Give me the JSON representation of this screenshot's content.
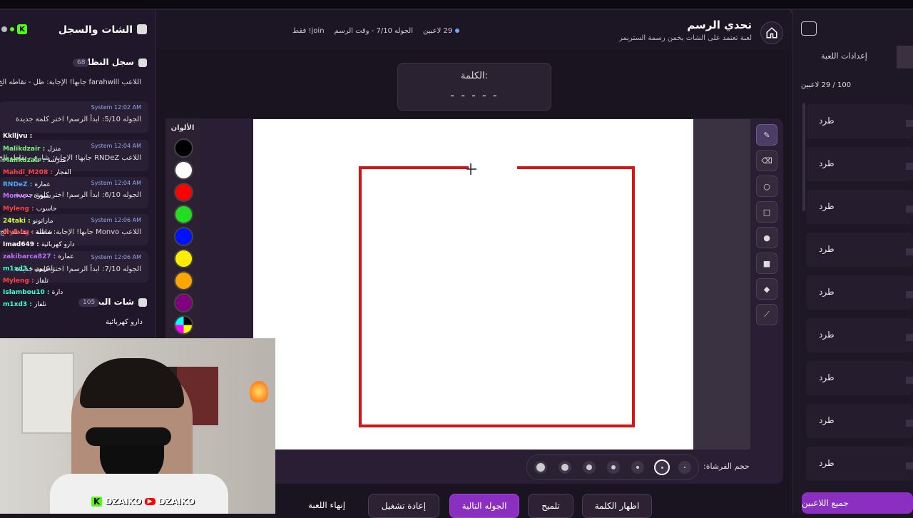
{
  "header": {
    "title": "تحدي الرسم",
    "subtitle": "لعبة تعتمد على الشات يخمن رسمة الستريمر",
    "players_count": "29 لاعبين",
    "round_info": "الجوله 7/10 - وقت الرسم",
    "join_info": "join! فقط"
  },
  "word_card": {
    "label": "الكلمة:",
    "blanks": "- - - - -"
  },
  "palette": {
    "title": "الألوان",
    "colors": [
      "#000000",
      "#ffffff",
      "#ff0000",
      "#22dd22",
      "#0011ff",
      "#ffee00",
      "#ffa500",
      "#800080"
    ]
  },
  "brush": {
    "label": "حجم الفرشاة:"
  },
  "tools": [
    "brush-icon",
    "eraser-icon",
    "circle-icon",
    "square-icon",
    "filled-circle-icon",
    "filled-square-icon",
    "fill-icon",
    "line-icon"
  ],
  "bottom_buttons": {
    "end_game": "إنهاء اللعبة",
    "restart": "إعادة تشغيل",
    "next_round": "الجوله التالية",
    "hint": "تلميح",
    "show_word": "اظهار الكلمة"
  },
  "chat_panel": {
    "title": "الشات والسجل",
    "log_title": "سجل النظام",
    "log_count": "68",
    "stream_chat_title": "شات البث",
    "stream_chat_count": "105",
    "last_message": "دارو كهربائية",
    "system_entries": [
      {
        "author": "",
        "time": "",
        "text": "اللاعب farahwill جابها! الإجابة: ظل - نقاطه الج"
      },
      {
        "author": "System",
        "time": "12:02 AM",
        "text": "الجوله 5/10: ابدأ الرسم! اختر كلمة جديدة"
      },
      {
        "author": "System",
        "time": "12:04 AM",
        "text": "اللاعب RNDeZ جابها! الإجابة: شارع - نقاطه الج"
      },
      {
        "author": "System",
        "time": "12:04 AM",
        "text": "الجوله 6/10: ابدأ الرسم! اختر كلمة جديدة"
      },
      {
        "author": "System",
        "time": "12:06 AM",
        "text": "اللاعب Monvo جابها! الإجابة: مظلة - نقاطه الج"
      },
      {
        "author": "System",
        "time": "12:06 AM",
        "text": "الجوله 7/10: ابدأ الرسم! اختر كلمة جديدة"
      }
    ],
    "overlay_chat": [
      {
        "user": "Kklljvu :",
        "msg": "",
        "color": "#ffffff"
      },
      {
        "user": "Malikdzair :",
        "msg": "منزل",
        "color": "#7cf27c"
      },
      {
        "user": "Malikdzair :",
        "msg": "مدرسة",
        "color": "#7cf27c"
      },
      {
        "user": "Mahdi_M208 :",
        "msg": "الفجار",
        "color": "#ff4040"
      },
      {
        "user": "RNDeZ :",
        "msg": "عمارة",
        "color": "#4aa8ff"
      },
      {
        "user": "Monvo :",
        "msg": "سبورة",
        "color": "#c070ff"
      },
      {
        "user": "Myleng :",
        "msg": "حاسوب",
        "color": "#ff4040"
      },
      {
        "user": "24taki :",
        "msg": "ماراتونو",
        "color": "#d0ff40"
      },
      {
        "user": "Myleng :",
        "msg": "شاشة",
        "color": "#ff4040"
      },
      {
        "user": "Imad649 :",
        "msg": "دارو كهربائية",
        "color": "#ffffff"
      },
      {
        "user": "zakibarca827 :",
        "msg": "عمارة",
        "color": "#c070ff"
      },
      {
        "user": "m1xd3 :",
        "msg": "تلفزيون",
        "color": "#40ffd0"
      },
      {
        "user": "Myleng :",
        "msg": "تلفاز",
        "color": "#ff4040"
      },
      {
        "user": "Islambou10 :",
        "msg": "دارة",
        "color": "#40ffd0"
      },
      {
        "user": "m1xd3 :",
        "msg": "تلفاز",
        "color": "#40ffd0"
      }
    ]
  },
  "right_panel": {
    "tab_settings": "إعدادات اللعبة",
    "player_count": "100 / 29 لاعبين",
    "kick_label": "طرد",
    "kick_rows": 9,
    "bottom_button": "جميع اللاعبين"
  },
  "webcam": {
    "brand_left": "DZAIKO",
    "brand_right": "DZAIKO"
  }
}
